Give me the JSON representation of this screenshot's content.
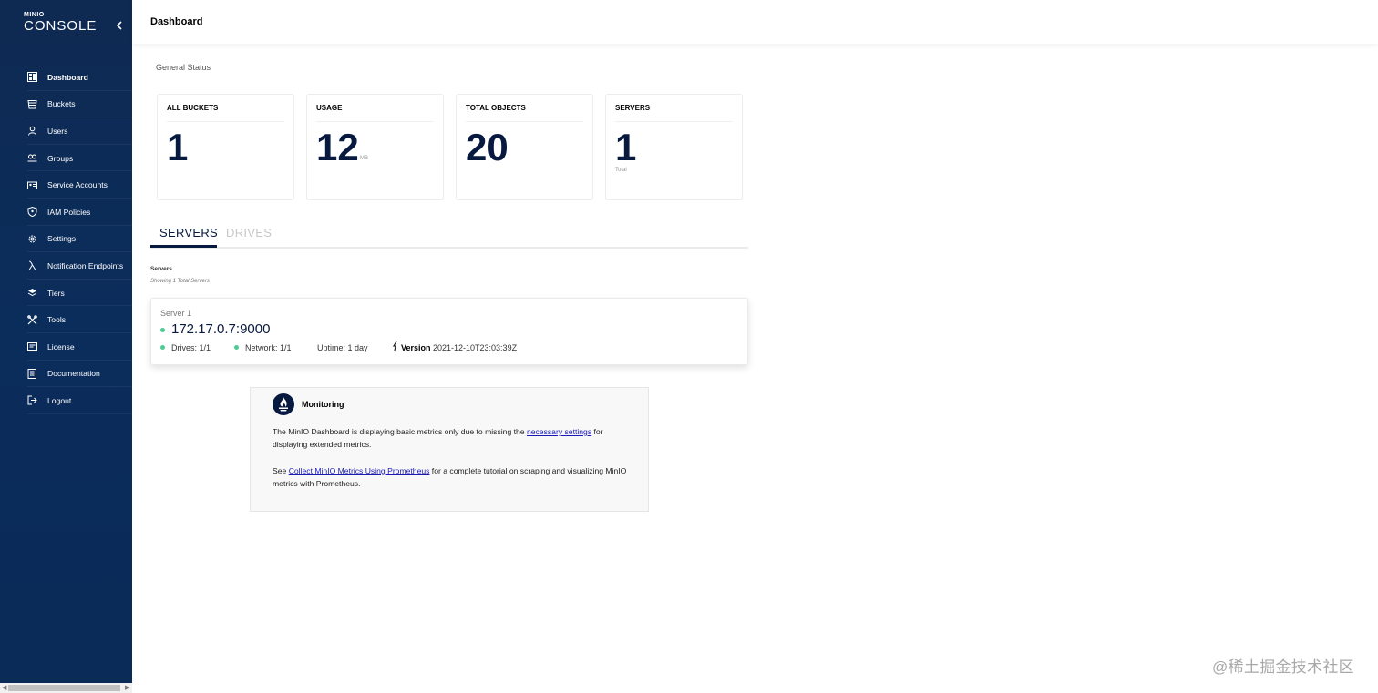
{
  "brand": {
    "small": "MINIO",
    "name": "CONSOLE"
  },
  "sidebar": {
    "items": [
      {
        "label": "Dashboard",
        "icon": "dashboard-icon",
        "active": true
      },
      {
        "label": "Buckets",
        "icon": "bucket-icon"
      },
      {
        "label": "Users",
        "icon": "user-icon"
      },
      {
        "label": "Groups",
        "icon": "groups-icon"
      },
      {
        "label": "Service Accounts",
        "icon": "service-accounts-icon"
      },
      {
        "label": "IAM Policies",
        "icon": "shield-icon"
      },
      {
        "label": "Settings",
        "icon": "gear-icon"
      },
      {
        "label": "Notification Endpoints",
        "icon": "lambda-icon"
      },
      {
        "label": "Tiers",
        "icon": "layers-icon"
      },
      {
        "label": "Tools",
        "icon": "tools-icon"
      },
      {
        "label": "License",
        "icon": "license-icon"
      },
      {
        "label": "Documentation",
        "icon": "documentation-icon"
      },
      {
        "label": "Logout",
        "icon": "logout-icon"
      }
    ]
  },
  "header": {
    "title": "Dashboard"
  },
  "general_status": {
    "label": "General Status",
    "cards": [
      {
        "title": "ALL BUCKETS",
        "value": "1",
        "unit": ""
      },
      {
        "title": "USAGE",
        "value": "12",
        "unit": "MB"
      },
      {
        "title": "TOTAL OBJECTS",
        "value": "20",
        "unit": ""
      },
      {
        "title": "SERVERS",
        "value": "1",
        "unit": "Total"
      }
    ]
  },
  "tabs": [
    {
      "label": "SERVERS",
      "active": true
    },
    {
      "label": "DRIVES",
      "active": false
    }
  ],
  "servers": {
    "heading": "Servers",
    "subheading": "Showing 1 Total Servers",
    "list": [
      {
        "name": "Server 1",
        "endpoint": "172.17.0.7:9000",
        "drives": "Drives: 1/1",
        "network": "Network: 1/1",
        "uptime": "Uptime: 1 day",
        "version_label": "Version",
        "version": "2021-12-10T23:03:39Z"
      }
    ]
  },
  "monitoring": {
    "title": "Monitoring",
    "p1_before": "The MinIO Dashboard is displaying basic metrics only due to missing the ",
    "p1_link": "necessary settings",
    "p1_after": " for displaying extended metrics.",
    "p2_before": "See ",
    "p2_link": "Collect MinIO Metrics Using Prometheus",
    "p2_after": " for a complete tutorial on scraping and visualizing MinIO metrics with Prometheus."
  },
  "watermark": "@稀土掘金技术社区",
  "colors": {
    "sidebar": "#0b2d5c",
    "accent": "#07193e",
    "online": "#4ccb92"
  }
}
